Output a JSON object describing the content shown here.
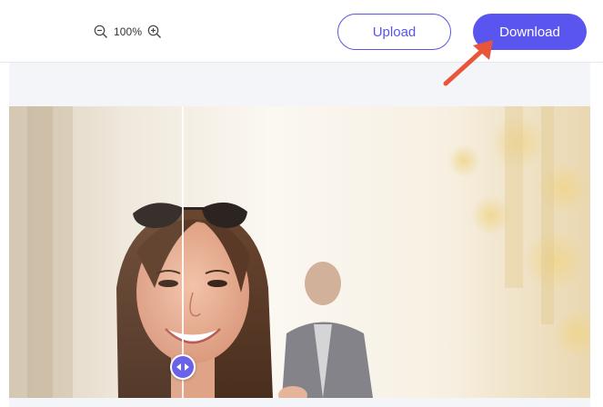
{
  "toolbar": {
    "zoom_level": "100%",
    "zoom_out_icon": "zoom-out-icon",
    "zoom_in_icon": "zoom-in-icon",
    "upload_label": "Upload",
    "download_label": "Download"
  },
  "colors": {
    "accent": "#5a55ef",
    "annotation_arrow": "#e8553a",
    "workspace_bg": "#f4f5f9"
  },
  "compare": {
    "handle_icon": "left-right-arrows-icon",
    "split_position": 0.3
  },
  "annotation": {
    "icon": "red-arrow-icon"
  }
}
